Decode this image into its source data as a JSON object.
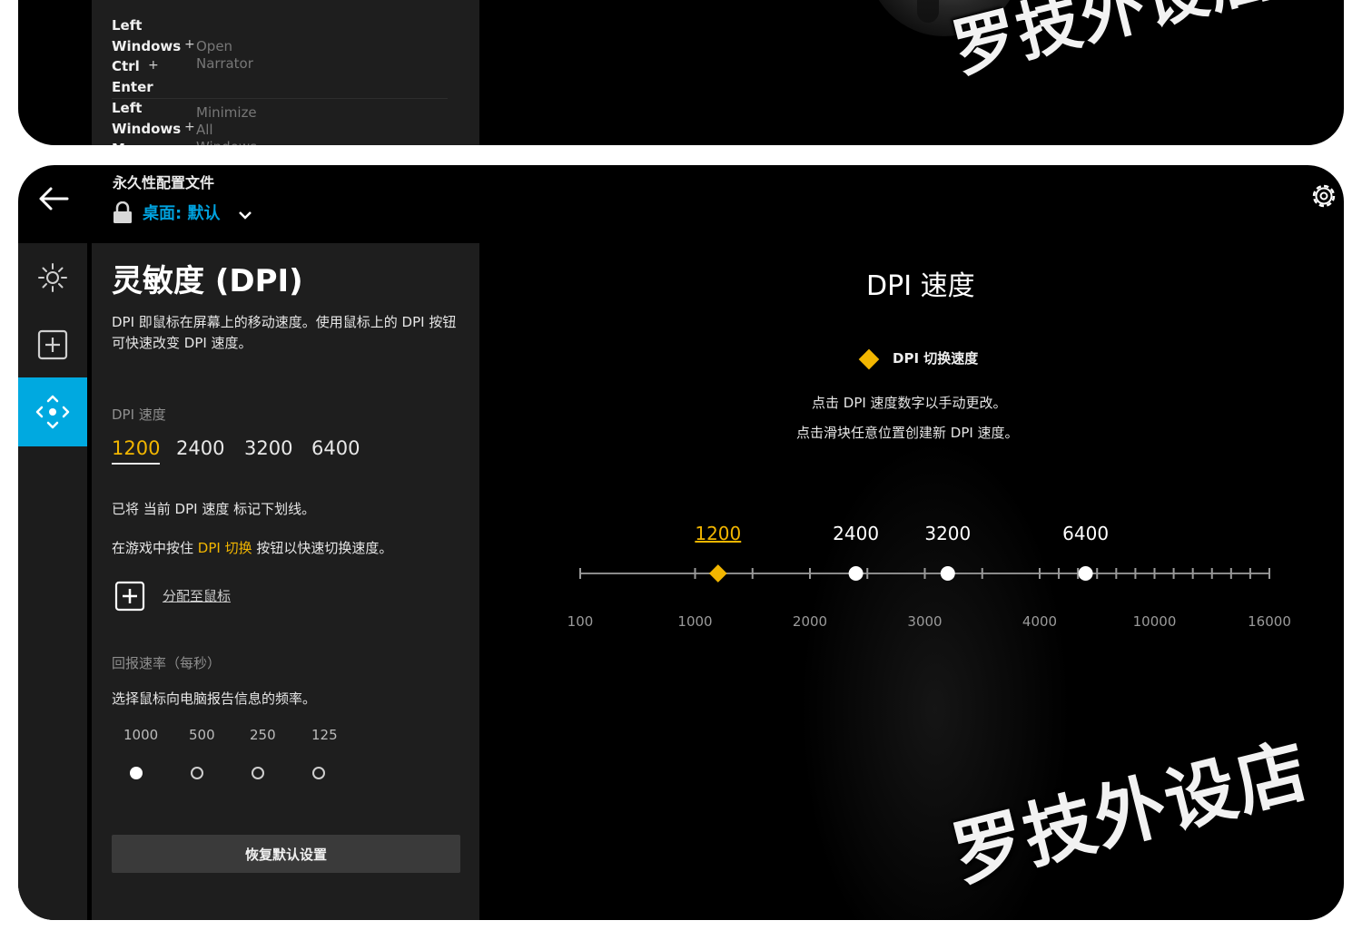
{
  "top_panel": {
    "shortcuts": [
      {
        "keys": "Left\nWindows\nCtrl\nEnter",
        "action": "Open\nNarrator"
      },
      {
        "keys": "Left\nWindows\nM",
        "action": "Minimize\nAll\nWindows"
      }
    ],
    "plus": "+"
  },
  "header": {
    "profile_label": "永久性配置文件",
    "profile_name": "桌面: 默认"
  },
  "nav": {
    "items": [
      {
        "icon": "lighting-icon",
        "active": false
      },
      {
        "icon": "assignments-icon",
        "active": false
      },
      {
        "icon": "pointer-dpi-icon",
        "active": true
      }
    ]
  },
  "settings": {
    "title": "灵敏度 (DPI)",
    "description": "DPI 即鼠标在屏幕上的移动速度。使用鼠标上的 DPI 按钮可快速改变 DPI 速度。",
    "dpi_label": "DPI 速度",
    "dpi_options": [
      "1200",
      "2400",
      "3200",
      "6400"
    ],
    "current_dpi": "1200",
    "note_underline": "已将 当前 DPI 速度 标记下划线。",
    "note_switch_prefix": "在游戏中按住 ",
    "note_switch_highlight": "DPI 切换",
    "note_switch_suffix": " 按钮以快速切换速度。",
    "assign_link": "分配至鼠标",
    "report_rate_label": "回报速率（每秒）",
    "report_rate_desc": "选择鼠标向电脑报告信息的频率。",
    "report_rates": [
      "1000",
      "500",
      "250",
      "125"
    ],
    "selected_report_rate": "1000",
    "reset_button": "恢复默认设置"
  },
  "chart": {
    "title": "DPI 速度",
    "legend_label": "DPI 切换速度",
    "hint_1": "点击 DPI 速度数字以手动更改。",
    "hint_2": "点击滑块任意位置创建新 DPI 速度。",
    "accent_color": "#f2b600",
    "brand_color": "#00a9e0"
  },
  "chart_data": {
    "type": "scatter",
    "axis_ticks": [
      "100",
      "1000",
      "2000",
      "3000",
      "4000",
      "10000",
      "16000"
    ],
    "points": [
      {
        "label": "1200",
        "value": 1200,
        "shift_speed": true
      },
      {
        "label": "2400",
        "value": 2400,
        "shift_speed": false
      },
      {
        "label": "3200",
        "value": 3200,
        "shift_speed": false
      },
      {
        "label": "6400",
        "value": 6400,
        "shift_speed": false
      }
    ]
  },
  "watermark": "罗技外设店"
}
